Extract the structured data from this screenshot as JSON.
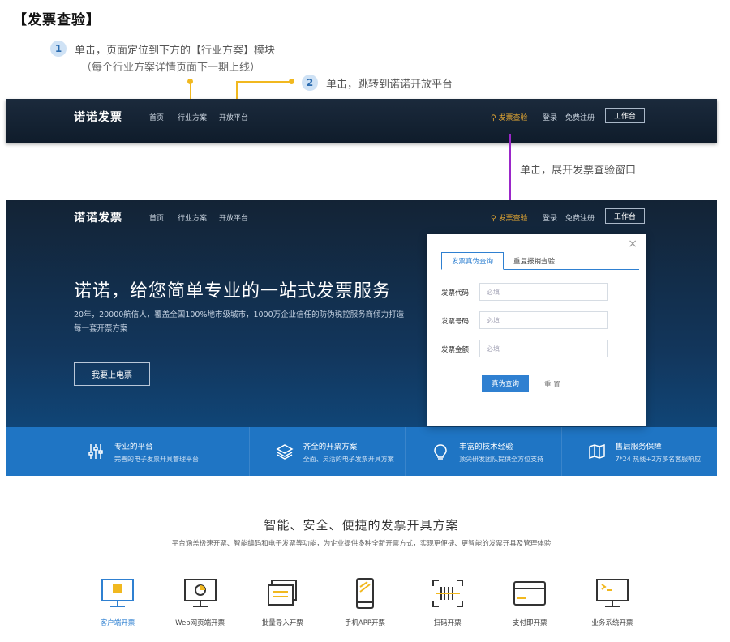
{
  "annotation": {
    "title": "【发票查验】",
    "step1_num": "1",
    "step1_text": "单击，页面定位到下方的【行业方案】模块",
    "step1_sub": "（每个行业方案详情页面下一期上线）",
    "step2_num": "2",
    "step2_text": "单击，跳转到诺诺开放平台",
    "step3_text": "单击，展开发票查验窗口"
  },
  "nav": {
    "logo": "诺诺发票",
    "items": [
      "首页",
      "行业方案",
      "开放平台"
    ],
    "search": "发票查验",
    "login": "登录",
    "register": "免费注册",
    "workbench": "工作台"
  },
  "hero": {
    "title": "诺诺，给您简单专业的一站式发票服务",
    "desc": "20年，20000航信人，覆盖全国100%地市级城市，1000万企业信任的防伪税控服务商倾力打造每一套开票方案",
    "button": "我要上电票"
  },
  "features": [
    {
      "title": "专业的平台",
      "desc": "完善的电子发票开具管理平台",
      "icon": "sliders-icon"
    },
    {
      "title": "齐全的开票方案",
      "desc": "全面、灵活的电子发票开具方案",
      "icon": "layers-icon"
    },
    {
      "title": "丰富的技术经验",
      "desc": "顶尖研发团队提供全方位支持",
      "icon": "bulb-icon"
    },
    {
      "title": "售后服务保障",
      "desc": "7*24 热线+2万多名客服响应",
      "icon": "map-icon"
    }
  ],
  "popup": {
    "close": "×",
    "tab_active": "发票真伪查询",
    "tab_other": "重复报销查验",
    "fields": [
      {
        "label": "发票代码",
        "placeholder": "必填"
      },
      {
        "label": "发票号码",
        "placeholder": "必填"
      },
      {
        "label": "发票金额",
        "placeholder": "必填"
      }
    ],
    "submit": "真伪查询",
    "reset": "重 置"
  },
  "solutions": {
    "title": "智能、安全、便捷的发票开具方案",
    "subtitle": "平台涵盖极速开票、智能编码和电子发票等功能，为企业提供多种全新开票方式，实现更便捷、更智能的发票开具及管理体验",
    "products": [
      {
        "label": "客户端开票",
        "icon": "monitor-icon"
      },
      {
        "label": "Web网页端开票",
        "icon": "web-monitor-icon"
      },
      {
        "label": "批量导入开票",
        "icon": "stack-icon"
      },
      {
        "label": "手机APP开票",
        "icon": "phone-icon"
      },
      {
        "label": "扫码开票",
        "icon": "barcode-icon"
      },
      {
        "label": "支付即开票",
        "icon": "card-icon"
      },
      {
        "label": "业务系统开票",
        "icon": "terminal-icon"
      }
    ]
  },
  "colors": {
    "accent": "#2f80d1",
    "highlight": "#f1b81f",
    "arrow": "#9b27c9"
  }
}
